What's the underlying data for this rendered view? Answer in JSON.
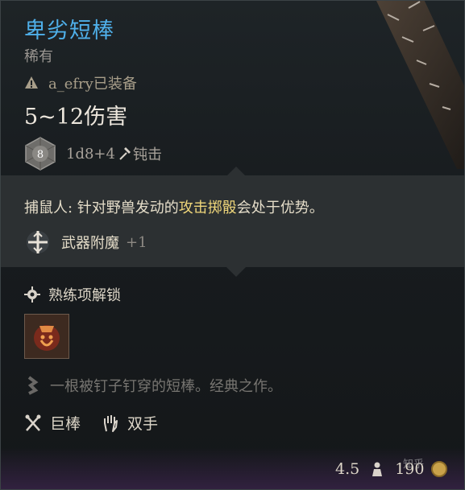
{
  "item": {
    "name": "卑劣短棒",
    "rarity": "稀有",
    "equipped_by": "a_efry已装备",
    "damage": "5~12伤害",
    "dice_value": "8",
    "dice_roll": "1d8+4",
    "damage_type": "钝击"
  },
  "passive": {
    "prefix": "捕鼠人: 针对野兽发动的",
    "highlight": "攻击掷骰",
    "suffix": "会处于优势。"
  },
  "enchant": {
    "label": "武器附魔",
    "value": "+1"
  },
  "proficiency": {
    "label": "熟练项解锁"
  },
  "description": "一根被钉子钉穿的短棒。经典之作。",
  "properties": [
    {
      "label": "巨棒",
      "icon": "crossed-clubs-icon"
    },
    {
      "label": "双手",
      "icon": "hand-icon"
    }
  ],
  "footer": {
    "weight": "4.5",
    "price": "190"
  },
  "watermark": "知乎",
  "colors": {
    "title": "#4fb0ea",
    "highlight": "#efd67a",
    "band": "#2c3032"
  }
}
